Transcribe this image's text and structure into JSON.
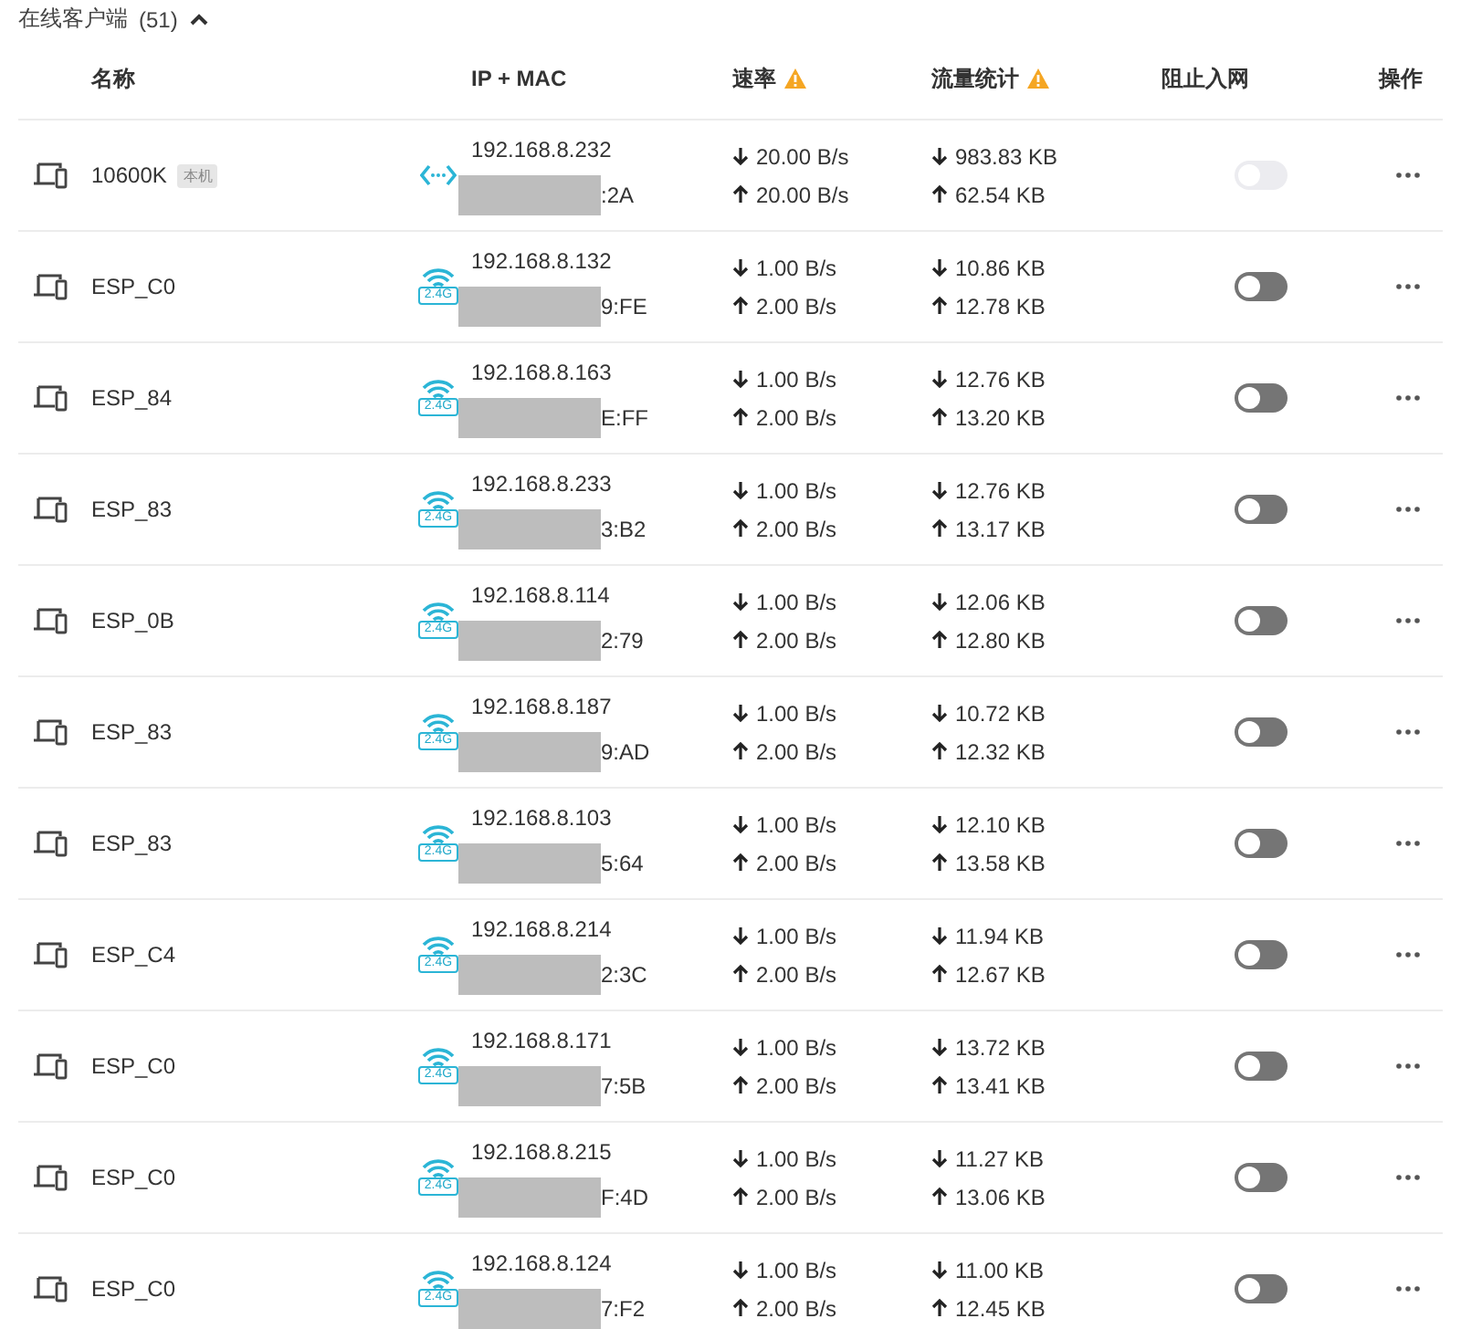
{
  "section": {
    "title": "在线客户端",
    "count": "(51)",
    "expanded": true
  },
  "columns": [
    {
      "label": "名称",
      "warning": false
    },
    {
      "label": "IP + MAC",
      "warning": false
    },
    {
      "label": "速率",
      "warning": true
    },
    {
      "label": "流量统计",
      "warning": true
    },
    {
      "label": "阻止入网",
      "warning": false
    },
    {
      "label": "操作",
      "warning": false
    }
  ],
  "rows": [
    {
      "name": "10600K",
      "tag": "本机",
      "kind": "wired",
      "ip": "192.168.8.232",
      "mac": ":2A",
      "down_rate": "20.00 B/s",
      "up_rate": "20.00 B/s",
      "down_total": "983.83 KB",
      "up_total": "62.54 KB",
      "blocked": false,
      "disabled": true
    },
    {
      "name": "ESP_C0",
      "kind": "wifi",
      "band": "2.4G",
      "ip": "192.168.8.132",
      "mac": "9:FE",
      "down_rate": "1.00 B/s",
      "up_rate": "2.00 B/s",
      "down_total": "10.86 KB",
      "up_total": "12.78 KB",
      "blocked": false,
      "disabled": false
    },
    {
      "name": "ESP_84",
      "kind": "wifi",
      "band": "2.4G",
      "ip": "192.168.8.163",
      "mac": "E:FF",
      "down_rate": "1.00 B/s",
      "up_rate": "2.00 B/s",
      "down_total": "12.76 KB",
      "up_total": "13.20 KB",
      "blocked": false,
      "disabled": false
    },
    {
      "name": "ESP_83",
      "kind": "wifi",
      "band": "2.4G",
      "ip": "192.168.8.233",
      "mac": "3:B2",
      "down_rate": "1.00 B/s",
      "up_rate": "2.00 B/s",
      "down_total": "12.76 KB",
      "up_total": "13.17 KB",
      "blocked": false,
      "disabled": false
    },
    {
      "name": "ESP_0B",
      "kind": "wifi",
      "band": "2.4G",
      "ip": "192.168.8.114",
      "mac": "2:79",
      "down_rate": "1.00 B/s",
      "up_rate": "2.00 B/s",
      "down_total": "12.06 KB",
      "up_total": "12.80 KB",
      "blocked": false,
      "disabled": false
    },
    {
      "name": "ESP_83",
      "kind": "wifi",
      "band": "2.4G",
      "ip": "192.168.8.187",
      "mac": "9:AD",
      "down_rate": "1.00 B/s",
      "up_rate": "2.00 B/s",
      "down_total": "10.72 KB",
      "up_total": "12.32 KB",
      "blocked": false,
      "disabled": false
    },
    {
      "name": "ESP_83",
      "kind": "wifi",
      "band": "2.4G",
      "ip": "192.168.8.103",
      "mac": "5:64",
      "down_rate": "1.00 B/s",
      "up_rate": "2.00 B/s",
      "down_total": "12.10 KB",
      "up_total": "13.58 KB",
      "blocked": false,
      "disabled": false
    },
    {
      "name": "ESP_C4",
      "kind": "wifi",
      "band": "2.4G",
      "ip": "192.168.8.214",
      "mac": "2:3C",
      "down_rate": "1.00 B/s",
      "up_rate": "2.00 B/s",
      "down_total": "11.94 KB",
      "up_total": "12.67 KB",
      "blocked": false,
      "disabled": false
    },
    {
      "name": "ESP_C0",
      "kind": "wifi",
      "band": "2.4G",
      "ip": "192.168.8.171",
      "mac": "7:5B",
      "down_rate": "1.00 B/s",
      "up_rate": "2.00 B/s",
      "down_total": "13.72 KB",
      "up_total": "13.41 KB",
      "blocked": false,
      "disabled": false
    },
    {
      "name": "ESP_C0",
      "kind": "wifi",
      "band": "2.4G",
      "ip": "192.168.8.215",
      "mac": "F:4D",
      "down_rate": "1.00 B/s",
      "up_rate": "2.00 B/s",
      "down_total": "11.27 KB",
      "up_total": "13.06 KB",
      "blocked": false,
      "disabled": false
    },
    {
      "name": "ESP_C0",
      "kind": "wifi",
      "band": "2.4G",
      "ip": "192.168.8.124",
      "mac": "7:F2",
      "down_rate": "1.00 B/s",
      "up_rate": "2.00 B/s",
      "down_total": "11.00 KB",
      "up_total": "12.45 KB",
      "blocked": false,
      "disabled": false
    }
  ]
}
